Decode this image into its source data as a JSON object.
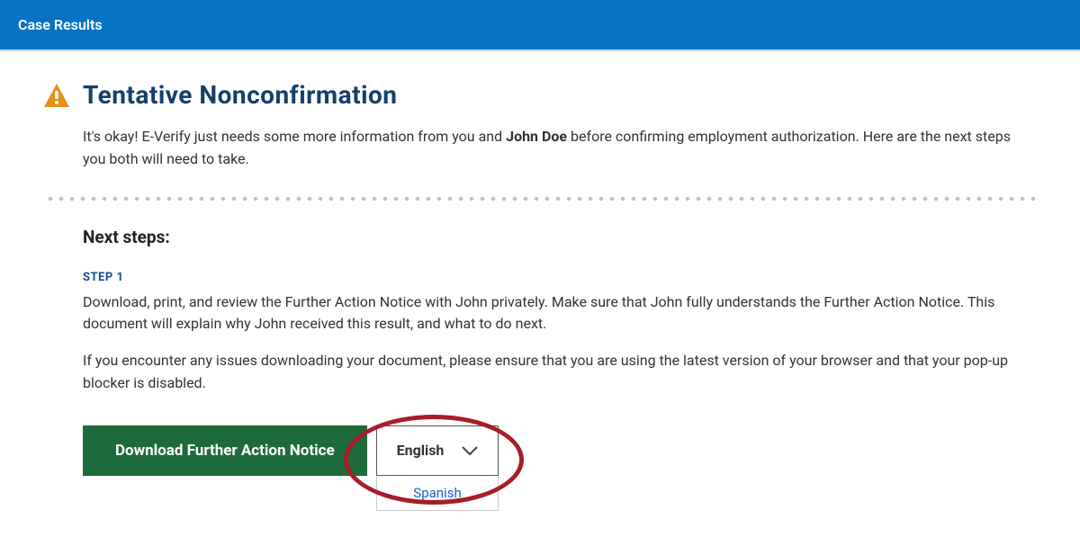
{
  "header": {
    "title": "Case Results"
  },
  "page": {
    "heading": "Tentative Nonconfirmation",
    "intro_pre": "It's okay! E-Verify just needs some more information from you and ",
    "employee_name": "John Doe",
    "intro_post": " before confirming employment authorization. Here are the next steps you both will need to take.",
    "next_steps_label": "Next steps:",
    "step1": {
      "label": "STEP 1",
      "p1": "Download, print, and review the Further Action Notice with John privately. Make sure that John fully understands the Further Action Notice. This document will explain why John received this result, and what to do next.",
      "p2": "If you encounter any issues downloading your document, please ensure that you are using the latest version of your browser and that your pop-up blocker is disabled."
    },
    "download_button": "Download Further Action Notice",
    "language": {
      "selected": "English",
      "option_spanish": "Spanish"
    }
  },
  "colors": {
    "brand_blue": "#0673c4",
    "heading_navy": "#163e6b",
    "button_green": "#1d6b3b",
    "highlight_red": "#a71d2a"
  }
}
